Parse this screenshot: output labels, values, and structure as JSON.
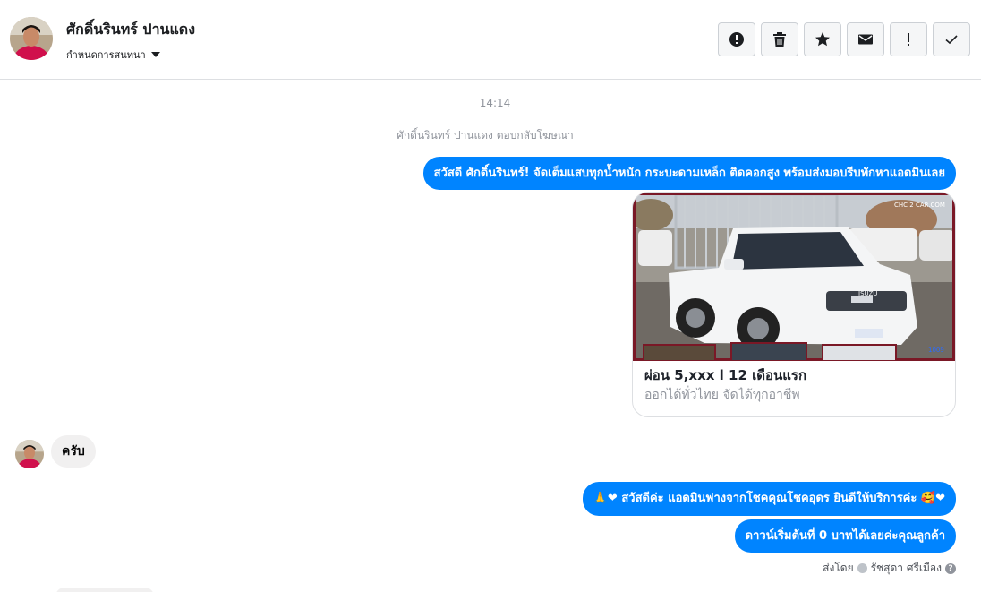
{
  "header": {
    "contact_name": "ศักดิ์นรินทร์ ปานแดง",
    "conversation_settings_label": "กำหนดการสนทนา",
    "actions": [
      {
        "name": "report-spam-button",
        "icon": "alert-circle-icon"
      },
      {
        "name": "delete-button",
        "icon": "trash-icon"
      },
      {
        "name": "star-button",
        "icon": "star-icon"
      },
      {
        "name": "mark-unread-button",
        "icon": "envelope-icon"
      },
      {
        "name": "follow-up-button",
        "icon": "exclamation-icon"
      },
      {
        "name": "mark-done-button",
        "icon": "check-icon"
      }
    ]
  },
  "thread": {
    "timestamp": "14:14",
    "reply_note": "ศักดิ์นรินทร์ ปานแดง ตอบกลับโฆษณา",
    "outgoing_greeting": "สวัสดี ศักดิ์นรินทร์! จัดเต็มแสบทุกน้ำหนัก กระบะดามเหล็ก ติดคอกสูง พร้อมส่งมอบรีบทักหาแอดมินเลย",
    "ad_card": {
      "title": "ผ่อน 5,xxx l 12 เดือนแรก",
      "subtitle": "ออกได้ทั่วไทย จัดได้ทุกอาชีพ",
      "watermark": "CHC 2 CAR.COM",
      "plate_text": "ISUZU",
      "corner_tag": "1009"
    },
    "incoming_reply": "ครับ",
    "outgoing_reply_1": "สวัสดีค่ะ แอดมินฟางจากโชคคุณโชคอุดร ยินดีให้บริการค่ะ",
    "outgoing_reply_1_prefix_emoji": "🙏❤",
    "outgoing_reply_1_suffix_emoji": "🥰❤",
    "outgoing_reply_2": "ดาวน์เริ่มต้นที่ 0 บาทได้เลยค่ะคุณลูกค้า",
    "sent_by_label": "ส่งโดย",
    "sent_by_name": "รัชสุดา ศรีเมือง",
    "help_glyph": "?"
  },
  "colors": {
    "brand_blue": "#0084ff",
    "incoming_bubble": "#f1f0f0",
    "muted_text": "#90949c",
    "border": "#dddfe2"
  }
}
